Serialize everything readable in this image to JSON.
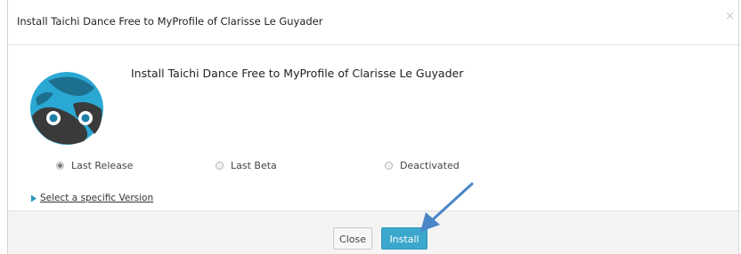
{
  "dialog": {
    "title": "Install Taichi Dance Free to MyProfile of Clarisse Le Guyader",
    "close_symbol": "×"
  },
  "app": {
    "icon_name": "taichi-dance-app-icon",
    "install_heading": "Install Taichi Dance Free to MyProfile of Clarisse Le Guyader"
  },
  "release_options": [
    {
      "label": "Last Release",
      "selected": true
    },
    {
      "label": "Last Beta",
      "selected": false
    },
    {
      "label": "Deactivated",
      "selected": false
    }
  ],
  "version_link": {
    "label": "Select a specific Version",
    "icon": "chevron-right-icon"
  },
  "footer": {
    "close_label": "Close",
    "install_label": "Install"
  },
  "annotation": {
    "icon": "arrow-pointer",
    "color": "#4a86c8"
  },
  "colors": {
    "accent": "#3ba7cc",
    "header_border": "#e2e2e2",
    "footer_bg": "#f4f4f4"
  }
}
